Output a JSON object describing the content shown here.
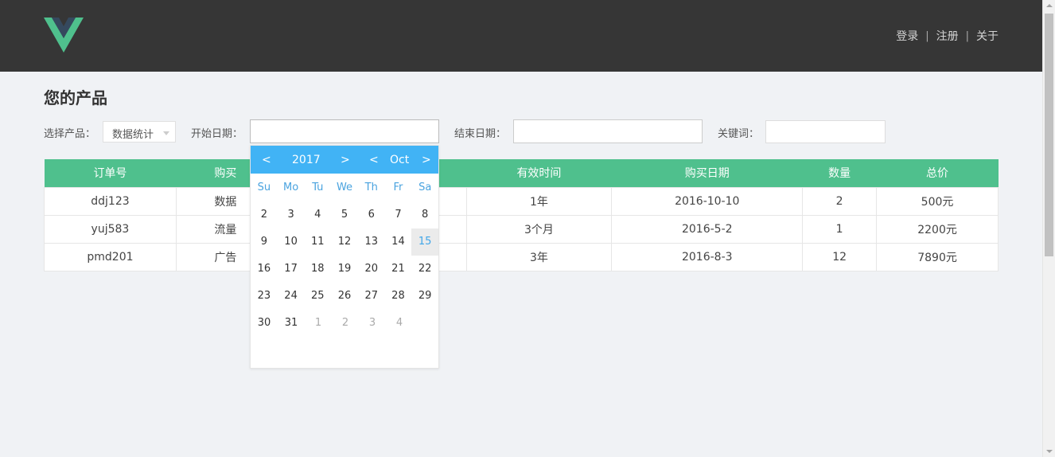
{
  "header": {
    "nav": {
      "login": "登录",
      "separator": "|",
      "register": "注册",
      "about": "关于"
    }
  },
  "page": {
    "title": "您的产品"
  },
  "filters": {
    "product_label": "选择产品：",
    "product_value": "数据统计",
    "start_label": "开始日期：",
    "start_value": "",
    "end_label": "结束日期：",
    "end_value": "",
    "keyword_label": "关键词：",
    "keyword_value": ""
  },
  "table": {
    "columns": [
      "订单号",
      "购买",
      "",
      "有效时间",
      "购买日期",
      "数量",
      "总价"
    ],
    "rows": [
      [
        "ddj123",
        "数据",
        "",
        "1年",
        "2016-10-10",
        "2",
        "500元"
      ],
      [
        "yuj583",
        "流量",
        "",
        "3个月",
        "2016-5-2",
        "1",
        "2200元"
      ],
      [
        "pmd201",
        "广告",
        "",
        "3年",
        "2016-8-3",
        "12",
        "7890元"
      ]
    ]
  },
  "datepicker": {
    "prev_year": "<",
    "year": "2017",
    "next_year": ">",
    "prev_month": "<",
    "month": "Oct",
    "next_month": ">",
    "weekdays": [
      "Su",
      "Mo",
      "Tu",
      "We",
      "Th",
      "Fr",
      "Sa"
    ],
    "weeks": [
      [
        "2",
        "3",
        "4",
        "5",
        "6",
        "7",
        "8"
      ],
      [
        "9",
        "10",
        "11",
        "12",
        "13",
        "14",
        "15"
      ],
      [
        "16",
        "17",
        "18",
        "19",
        "20",
        "21",
        "22"
      ],
      [
        "23",
        "24",
        "25",
        "26",
        "27",
        "28",
        "29"
      ],
      [
        "30",
        "31",
        "1",
        "2",
        "3",
        "4"
      ]
    ],
    "highlighted_day": "15"
  },
  "colors": {
    "header_bg": "#363636",
    "table_header": "#4fc08d",
    "datepicker_header": "#41b3f5",
    "logo_green": "#4fc08d",
    "logo_dark": "#35495e"
  }
}
